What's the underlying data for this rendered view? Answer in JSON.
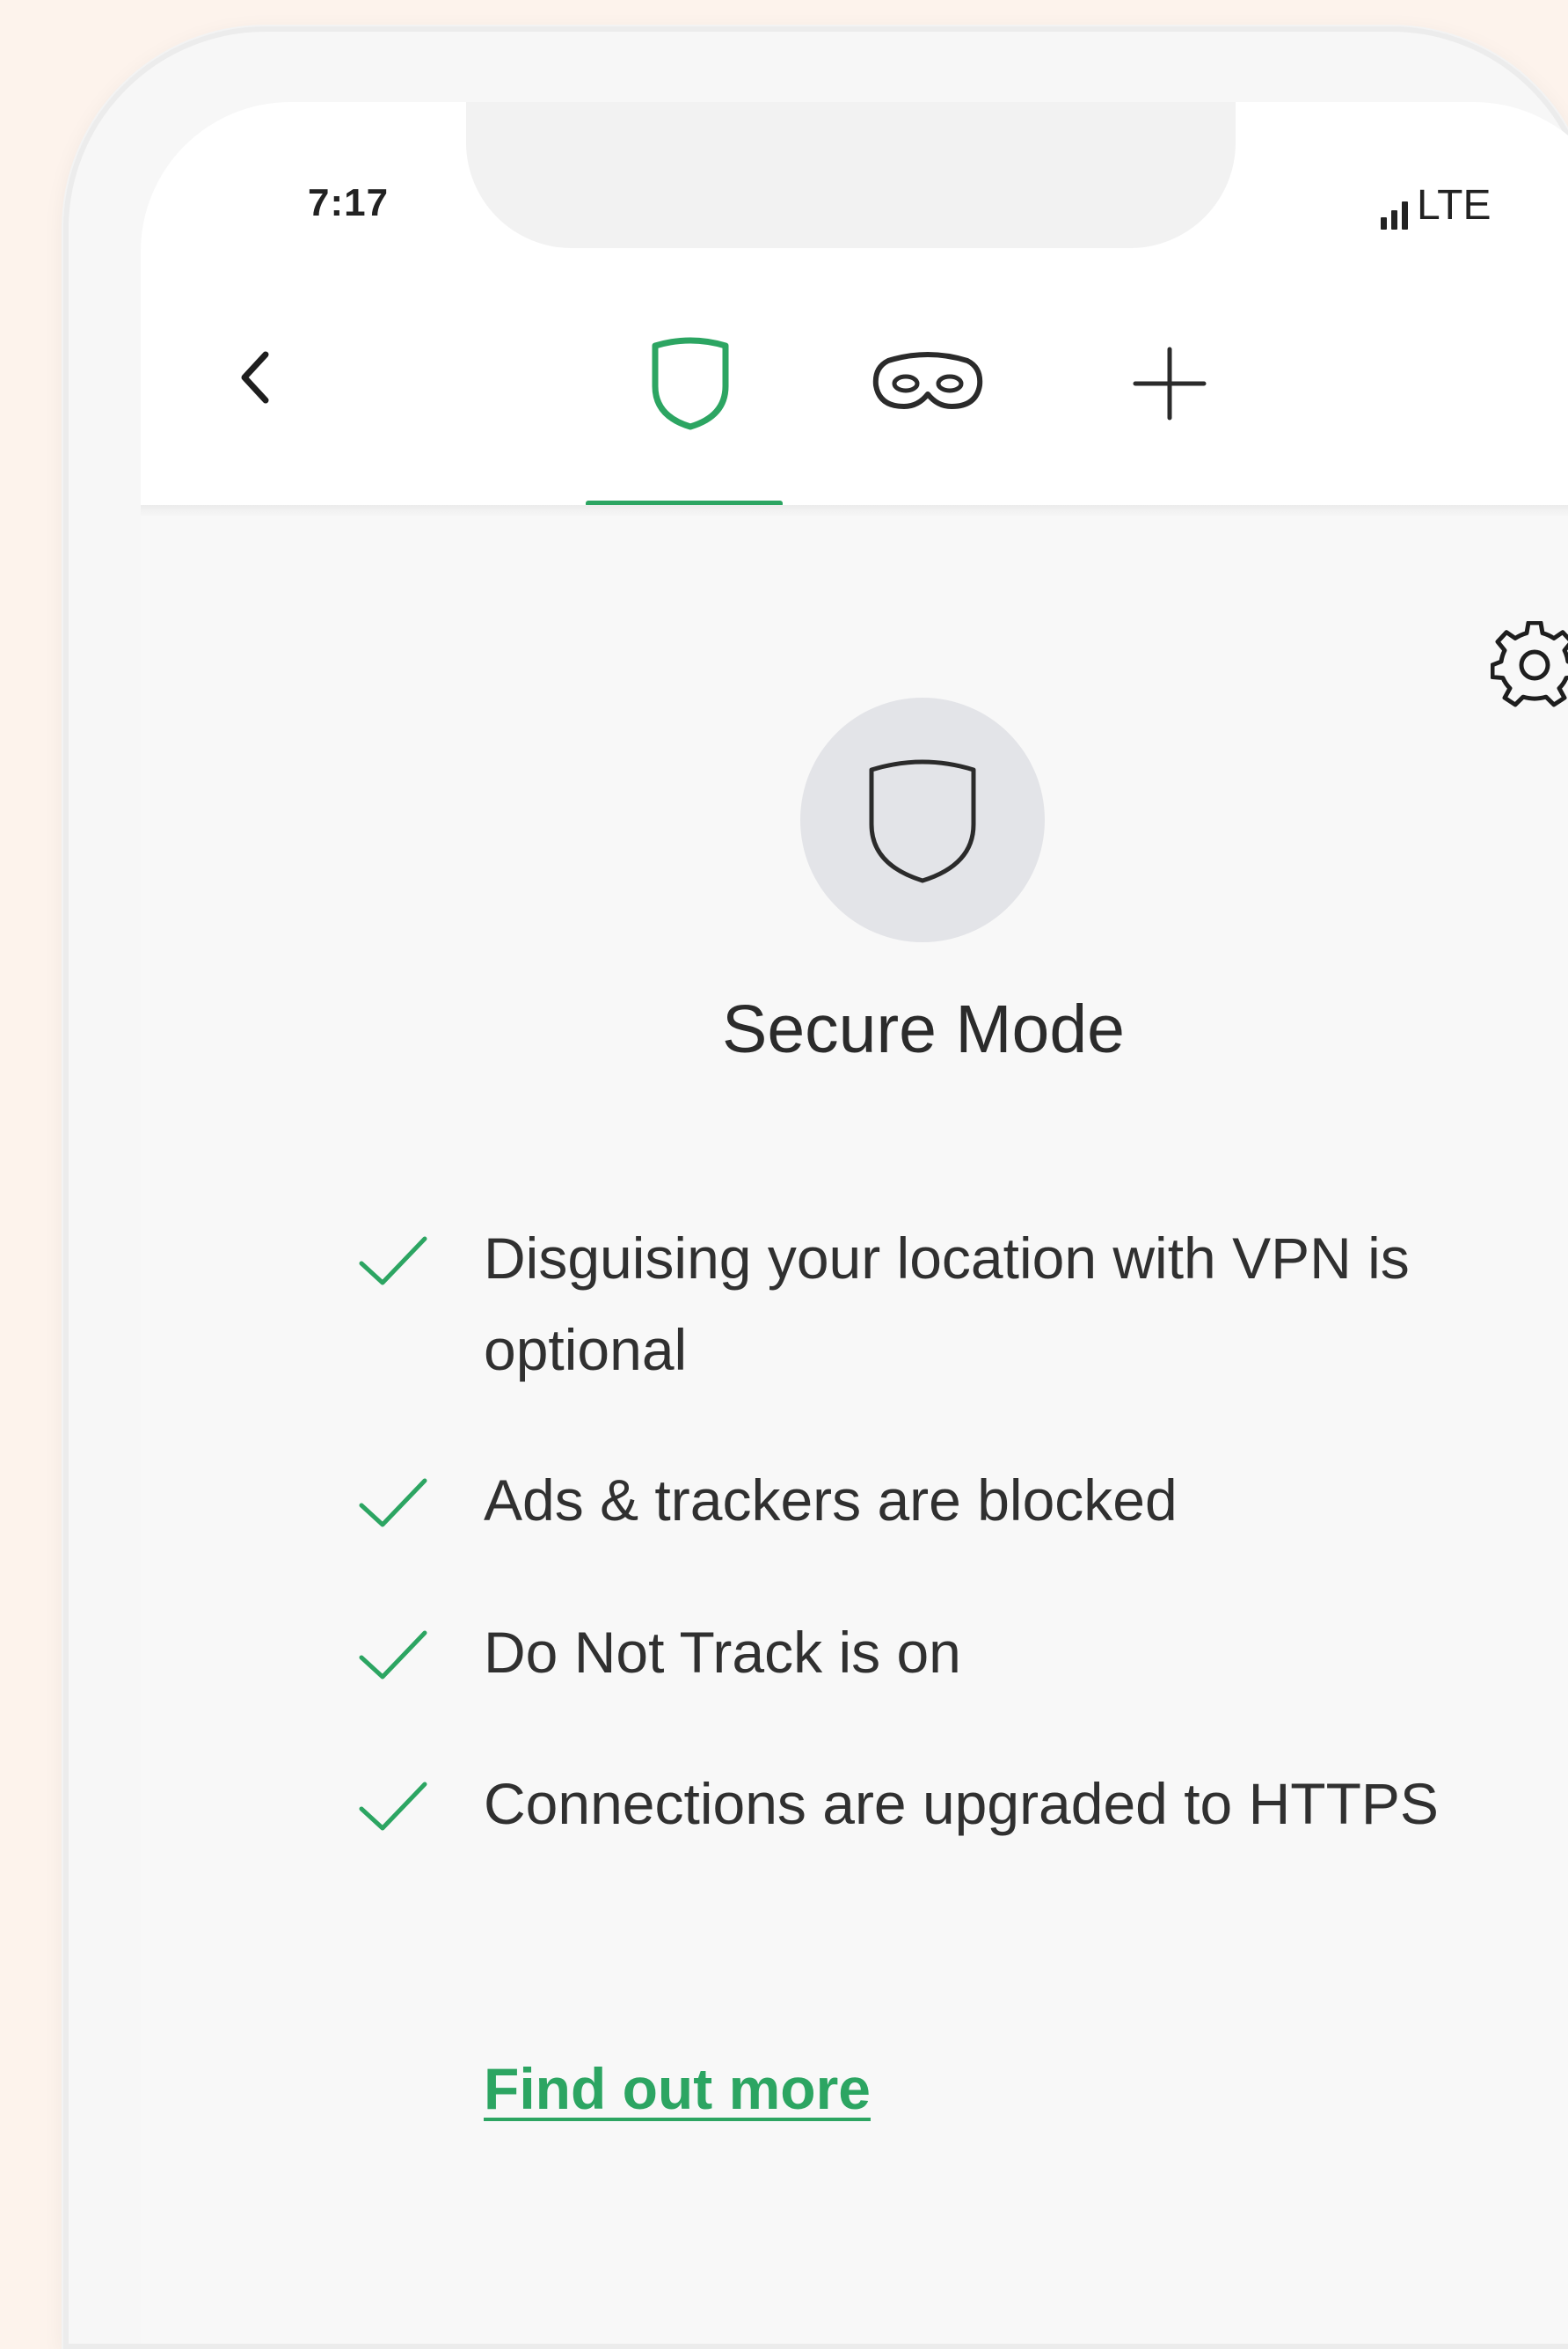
{
  "status_bar": {
    "time": "7:17",
    "network": "LTE"
  },
  "nav": {
    "back_icon": "chevron-left-icon",
    "tabs": [
      {
        "icon": "shield-icon",
        "active": true
      },
      {
        "icon": "mask-icon",
        "active": false
      },
      {
        "icon": "plus-icon",
        "active": false
      }
    ],
    "settings_icon": "gear-icon"
  },
  "mode": {
    "icon": "shield-icon",
    "title": "Secure Mode"
  },
  "features": [
    {
      "icon": "check-icon",
      "text": "Disguising your location with VPN is optional"
    },
    {
      "icon": "check-icon",
      "text": "Ads & trackers are blocked"
    },
    {
      "icon": "check-icon",
      "text": "Do Not Track is on"
    },
    {
      "icon": "check-icon",
      "text": "Connections are upgraded to HTTPS"
    }
  ],
  "link": {
    "label": "Find out more"
  },
  "colors": {
    "accent": "#2ca562",
    "page_background": "#fdf3ec",
    "screen_background": "#f8f8f8",
    "circle_background": "#e3e4e8",
    "text": "#2b2b2b"
  }
}
